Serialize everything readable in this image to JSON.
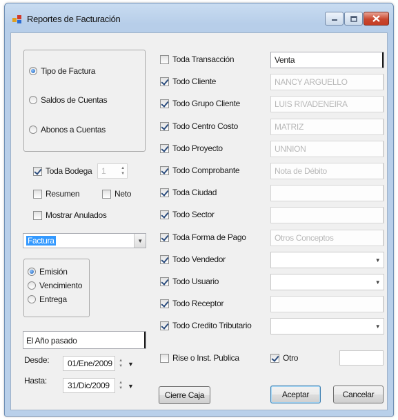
{
  "window": {
    "title": "Reportes de Facturación",
    "accent": "#3399ff"
  },
  "tipo_group": {
    "options": [
      {
        "label": "Tipo de Factura",
        "checked": true
      },
      {
        "label": "Saldos de Cuentas",
        "checked": false
      },
      {
        "label": "Abonos a Cuentas",
        "checked": false
      }
    ]
  },
  "bodega": {
    "toda_label": "Toda Bodega",
    "toda_checked": true,
    "value": "1"
  },
  "resumen": {
    "label": "Resumen",
    "checked": false
  },
  "neto": {
    "label": "Neto",
    "checked": false
  },
  "mostrar_anulados": {
    "label": "Mostrar Anulados",
    "checked": false
  },
  "document_type": {
    "selected": "Factura"
  },
  "fecha_group": {
    "options": [
      {
        "label": "Emisión",
        "checked": true
      },
      {
        "label": "Vencimiento",
        "checked": false
      },
      {
        "label": "Entrega",
        "checked": false
      }
    ]
  },
  "periodo": {
    "selected": "El Año pasado"
  },
  "desde": {
    "label": "Desde:",
    "value": "01/Ene/2009"
  },
  "hasta": {
    "label": "Hasta:",
    "value": "31/Dic/2009"
  },
  "filters": [
    {
      "label": "Toda Transacción",
      "checked": false,
      "value": "Venta",
      "style": "active"
    },
    {
      "label": "Todo Cliente",
      "checked": true,
      "value": "NANCY ARGUELLO",
      "style": "disabled"
    },
    {
      "label": "Todo Grupo Cliente",
      "checked": true,
      "value": "LUIS RIVADENEIRA",
      "style": "disabled"
    },
    {
      "label": "Todo Centro Costo",
      "checked": true,
      "value": "MATRIZ",
      "style": "disabled"
    },
    {
      "label": "Todo Proyecto",
      "checked": true,
      "value": "UNNION",
      "style": "disabled"
    },
    {
      "label": "Todo Comprobante",
      "checked": true,
      "value": "Nota de Débito",
      "style": "disabled"
    },
    {
      "label": "Toda Ciudad",
      "checked": true,
      "value": "",
      "style": "disabled"
    },
    {
      "label": "Todo Sector",
      "checked": true,
      "value": "",
      "style": "disabled"
    },
    {
      "label": "Toda Forma de Pago",
      "checked": true,
      "value": "Otros Conceptos",
      "style": "disabled"
    },
    {
      "label": "Todo Vendedor",
      "checked": true,
      "value": "",
      "style": "combo"
    },
    {
      "label": "Todo Usuario",
      "checked": true,
      "value": "",
      "style": "combo"
    },
    {
      "label": "Todo Receptor",
      "checked": true,
      "value": "",
      "style": "disabled"
    },
    {
      "label": "Todo Credito Tributario",
      "checked": true,
      "value": "",
      "style": "combo"
    }
  ],
  "rise": {
    "label": "Rise o Inst. Publica",
    "checked": false
  },
  "otro": {
    "label": "Otro",
    "checked": true,
    "value": ""
  },
  "buttons": {
    "cierre_caja": "Cierre Caja",
    "aceptar": "Aceptar",
    "cancelar": "Cancelar"
  }
}
